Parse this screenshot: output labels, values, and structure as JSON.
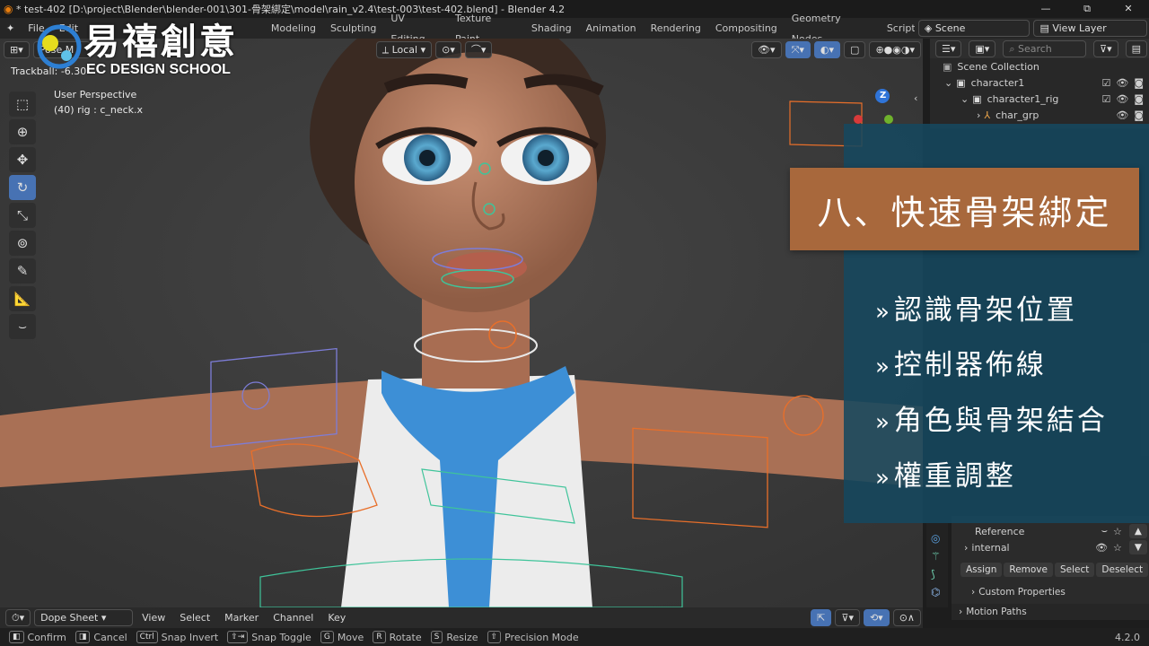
{
  "window": {
    "title": "* test-402 [D:\\project\\Blender\\blender-001\\301-骨架綁定\\model\\rain_v2.4\\test-003\\test-402.blend] - Blender 4.2",
    "restore": "⧉"
  },
  "menu": {
    "file": "File",
    "edit": "Edit",
    "workspaces": [
      "Modeling",
      "Sculpting",
      "UV Editing",
      "Texture Paint",
      "Shading",
      "Animation",
      "Rendering",
      "Compositing",
      "Geometry Nodes",
      "Scripti"
    ],
    "scene": "Scene",
    "view_layer": "View Layer"
  },
  "viewport": {
    "mode": "Pose M",
    "trackball": "Trackball: -6.30",
    "transform_space": "Local",
    "perspective": "User Perspective",
    "selection_info": "(40) rig : c_neck.x",
    "gizmo_axis": "Z"
  },
  "logo": {
    "name": "易禧創意",
    "sub": "EC DESIGN SCHOOL"
  },
  "overlay": {
    "title": "八、快速骨架綁定",
    "bullets": [
      "認識骨架位置",
      "控制器佈線",
      "角色與骨架結合",
      "權重調整"
    ],
    "chevron": "»"
  },
  "outliner": {
    "search_placeholder": "Search",
    "items": [
      {
        "label": "Scene Collection"
      },
      {
        "label": "character1"
      },
      {
        "label": "character1_rig"
      },
      {
        "label": "char_grp"
      }
    ]
  },
  "properties": {
    "collections": [
      {
        "label": "Reference"
      },
      {
        "label": "internal"
      }
    ],
    "buttons": [
      "Assign",
      "Remove",
      "Select",
      "Deselect"
    ],
    "custom_properties": "Custom Properties",
    "motion_paths": "Motion Paths"
  },
  "timeline": {
    "editor": "Dope Sheet",
    "menus": [
      "View",
      "Select",
      "Marker",
      "Channel",
      "Key"
    ]
  },
  "statusbar": {
    "items": [
      {
        "key": "",
        "label": "Confirm"
      },
      {
        "key": "",
        "label": "Cancel"
      },
      {
        "key": "Ctrl",
        "label": "Snap Invert"
      },
      {
        "key": "",
        "label": "Snap Toggle"
      },
      {
        "key": "G",
        "label": "Move"
      },
      {
        "key": "R",
        "label": "Rotate"
      },
      {
        "key": "S",
        "label": "Resize"
      },
      {
        "key": "",
        "label": "Precision Mode"
      }
    ],
    "version": "4.2.0"
  },
  "colors": {
    "accent": "#4772b3",
    "overlay_panel": "#16485f",
    "title_box": "#a8683c",
    "scarf": "#3d8fd6",
    "skin": "#b87e5c"
  }
}
